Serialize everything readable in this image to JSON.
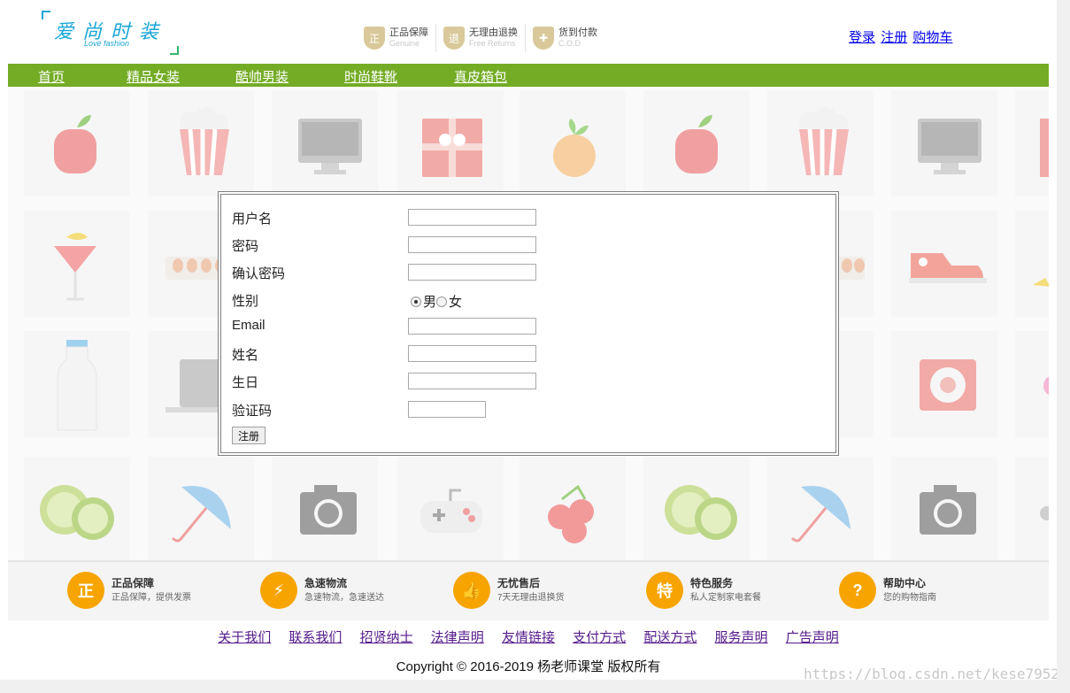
{
  "logo": {
    "text_cn": "爱尚时装",
    "text_en": "Love fashion"
  },
  "guarantees": [
    {
      "icon": "shield-zheng-icon",
      "glyph": "正",
      "main": "正品保障",
      "sub": "Genuine"
    },
    {
      "icon": "shield-tui-icon",
      "glyph": "退",
      "main": "无理由退换",
      "sub": "Free Returns"
    },
    {
      "icon": "gift-cod-icon",
      "glyph": "✚",
      "main": "货到付款",
      "sub": "C.O.D"
    }
  ],
  "user_links": {
    "login": "登录",
    "register": "注册",
    "cart": "购物车"
  },
  "nav": [
    "首页",
    "精品女装",
    "酷帅男装",
    "时尚鞋靴",
    "真皮箱包"
  ],
  "form": {
    "labels": {
      "username": "用户名",
      "password": "密码",
      "confirm": "确认密码",
      "gender": "性别",
      "email": "Email",
      "name": "姓名",
      "birthday": "生日",
      "captcha": "验证码"
    },
    "gender_options": {
      "male": "男",
      "female": "女",
      "selected": "男"
    },
    "submit": "注册"
  },
  "services": [
    {
      "icon": "zheng-badge-icon",
      "glyph": "正",
      "title": "正品保障",
      "sub": "正品保障，提供发票"
    },
    {
      "icon": "lightning-delivery-icon",
      "glyph": "⚡",
      "title": "急速物流",
      "sub": "急速物流，急速送达"
    },
    {
      "icon": "thumbs-up-icon",
      "glyph": "👍",
      "title": "无忧售后",
      "sub": "7天无理由退换货"
    },
    {
      "icon": "te-badge-icon",
      "glyph": "特",
      "title": "特色服务",
      "sub": "私人定制家电套餐"
    },
    {
      "icon": "question-icon",
      "glyph": "?",
      "title": "帮助中心",
      "sub": "您的购物指南"
    }
  ],
  "footer_links": [
    "关于我们",
    "联系我们",
    "招贤纳士",
    "法律声明",
    "友情链接",
    "支付方式",
    "配送方式",
    "服务声明",
    "广告声明"
  ],
  "copyright": "Copyright © 2016-2019 杨老师课堂 版权所有",
  "watermark": "https://blog.csdn.net/kese7952",
  "colors": {
    "nav_bg": "#74ac26",
    "service_icon": "#f7a400",
    "logo_blue": "#1aa6d8"
  }
}
